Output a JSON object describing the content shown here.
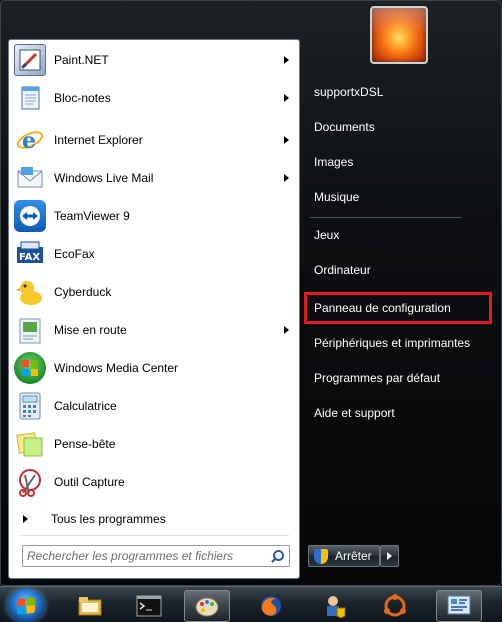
{
  "programs": [
    {
      "label": "Paint.NET",
      "has_submenu": true,
      "icon": "paintnet-icon"
    },
    {
      "label": "Bloc-notes",
      "has_submenu": true,
      "icon": "notepad-icon"
    },
    {
      "label": "Internet Explorer",
      "has_submenu": true,
      "icon": "internet-explorer-icon"
    },
    {
      "label": "Windows Live Mail",
      "has_submenu": true,
      "icon": "windows-live-mail-icon"
    },
    {
      "label": "TeamViewer 9",
      "has_submenu": false,
      "icon": "teamviewer-icon"
    },
    {
      "label": "EcoFax",
      "has_submenu": false,
      "icon": "ecofax-icon"
    },
    {
      "label": "Cyberduck",
      "has_submenu": false,
      "icon": "cyberduck-icon"
    },
    {
      "label": "Mise en route",
      "has_submenu": true,
      "icon": "getting-started-icon"
    },
    {
      "label": "Windows Media Center",
      "has_submenu": false,
      "icon": "media-center-icon"
    },
    {
      "label": "Calculatrice",
      "has_submenu": false,
      "icon": "calculator-icon"
    },
    {
      "label": "Pense-bête",
      "has_submenu": false,
      "icon": "sticky-notes-icon"
    },
    {
      "label": "Outil Capture",
      "has_submenu": false,
      "icon": "snipping-tool-icon"
    }
  ],
  "all_programs_label": "Tous les programmes",
  "search": {
    "placeholder": "Rechercher les programmes et fichiers"
  },
  "right_items": [
    {
      "label": "supportxDSL"
    },
    {
      "label": "Documents"
    },
    {
      "label": "Images"
    },
    {
      "label": "Musique"
    },
    {
      "label": "Jeux"
    },
    {
      "label": "Ordinateur"
    },
    {
      "label": "Panneau de configuration"
    },
    {
      "label": "Périphériques et imprimantes"
    },
    {
      "label": "Programmes par défaut"
    },
    {
      "label": "Aide et support"
    }
  ],
  "highlighted_item": "Panneau de configuration",
  "shutdown_label": "Arrêter",
  "colors": {
    "highlight_border": "#e01c23",
    "menu_text": "#ffffff"
  },
  "taskbar_items": [
    {
      "icon": "file-explorer-icon",
      "active": false
    },
    {
      "icon": "command-prompt-icon",
      "active": false
    },
    {
      "icon": "paint-palette-icon",
      "active": true
    },
    {
      "icon": "firefox-icon",
      "active": false
    },
    {
      "icon": "admin-tools-icon",
      "active": false
    },
    {
      "icon": "ubuntu-one-icon",
      "active": false
    },
    {
      "icon": "control-panel-icon",
      "active": true
    }
  ]
}
